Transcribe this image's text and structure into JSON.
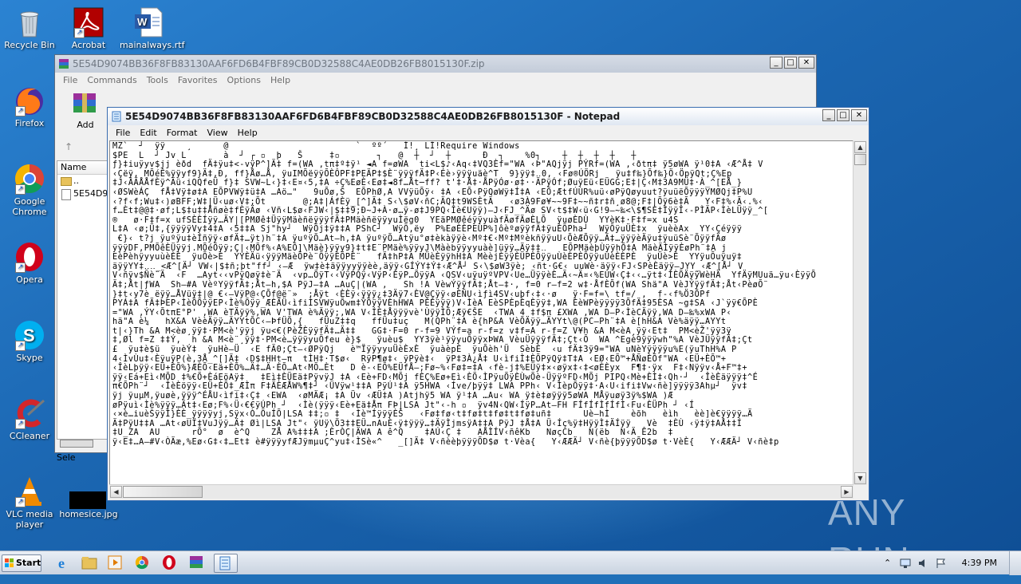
{
  "desktop": {
    "icons": [
      {
        "label": "Recycle Bin",
        "icon": "recycle-bin-icon"
      },
      {
        "label": "Acrobat",
        "icon": "acrobat-icon"
      },
      {
        "label": "mainalways.rtf",
        "icon": "word-document-icon"
      },
      {
        "label": "Firefox",
        "icon": "firefox-icon"
      },
      {
        "label": "Google Chrome",
        "icon": "chrome-icon"
      },
      {
        "label": "Opera",
        "icon": "opera-icon"
      },
      {
        "label": "Skype",
        "icon": "skype-icon"
      },
      {
        "label": "CCleaner",
        "icon": "ccleaner-icon"
      },
      {
        "label": "VLC media player",
        "icon": "vlc-icon"
      },
      {
        "label": "homesice.jpg",
        "icon": "image-file-icon"
      }
    ],
    "watermark": "ANY RUN"
  },
  "winrar": {
    "title": "5E54D9074BB36F8FB83130AAF6FD6B4FBF89CB0D32588C4AE0DB26FB8015130F.zip",
    "menu": [
      "File",
      "Commands",
      "Tools",
      "Favorites",
      "Options",
      "Help"
    ],
    "toolbar_add_label": "Add",
    "column_name": "Name",
    "rows": [
      "..",
      "5E54D9"
    ],
    "status_partial": "Sele"
  },
  "notepad": {
    "title": "5E54D9074BB36F8FB83130AAF6FD6B4FBF89CB0D32588C4AE0DB26FB8015130F - Notepad",
    "menu": [
      "File",
      "Edit",
      "Format",
      "View",
      "Help"
    ],
    "lines": [
      "MZ`  ┘  ÿÿ    ¸      @                        `  ºº´   Í!¸ LÍ!Require Windows",
      "$PE  L  ┘ Jv L       à  ┘ ┌ ▫  þ   Š     ‡▫       ┐   @  ┼  ┘  ┼      Ð  ┐    %0┐    ┼  ┼  ┼  ┼   ┼",
      "ƒ}‡iuÿyv$jj èðd  fÄ‡ÿu‡<-vÿP^]Ä‡ f=(WA ,tπ‡º‡ÿ¹ ◄A f=øWA  ti<L$♪‹Aq‹‡VQ3Èf=\"WA ‹Þ\"AQjÿj PÝRf=(WA ,‹ðtπ‡ ÿ5øWA ÿ¹0‡A ‹Æ^Å‡ V",
      "‹Çëÿ, MÕéÊ%ÿÿyf9}Ä‡,Ð, ff}Åø…Å, ÿuIMÕëÿÿÕÈÔPF‡PEÄP‡$È¨ÿÿÿfÄ‡P‹Éè›ÿÿÿuäè^T  9}ÿÿ‡‥0, ‹Fø®ÚÖRj   ÿu‡f‰}Õf‰}Ö‹ÖpÿQt;Ç%Ep",
      "‡J‹ÂÄÅÅfÈÿ^Ãü‹iQQfeÜ f}‡ SVW~L‹}‡‹E¤‹5,‡A ÷Ç%EøÈ‹Eø‡◄8f…Åt─ff? t'‡·Å‡·ÅPÿÓø·ø‡··ÄPÿÓf;ØuÿEü‹EÜGG;E‡|Ç‹M‡3A9MÜ‡·À_^[EÅ_}",
      "‹ØSWèÁÇ  fÅ‡Vÿ‡ø‡A EÕPVWÿ‡ü‡A …Aö…\"   9uÕø‚Š  EÕPhØ,A VVÿüÕÿ‹ ‡A ‹EÕ‹PÿQøWÿ‡Í‡A ‹EÕ;ÆtfÚÙR%uü‹øPÿQøyuut?ÿuüëÕÿÿÿYMØQj‡P%U",
      "‹?f‹f;Wu‡‹)øBFF;W‡|Ü‹uø‹V‡;Õt       @;A‡|ÁfÈÿ_[^]Ã‡ S‹\\$øV‹ñC;ÄQ‡t9WSÈtÃ   ‹ø3À9Fø¥~~9F‡~~ñ‡r‡ñ¸ø8@;F‡|Õÿ6è‡Ã   Y‹F‡%‹Ã‹.%‹",
      "f…Èt‡@@‡·øf;L$‡u‡‡Åñøè‡fÈÿÄø ‹Vñ‹L$ø‹FJW‹|$‡‡9;Ð~J+À·ø…ÿ-ø‡J9PQ‹Îè€Uÿÿ)—J‹FJ_^Äø SV‹t$‡W‹ü‹G!9—~‰<\\$¶SÈ‡ÌÿÿÎ‹-PÌÄP‹ÌèLÜÿÿ_^[",
      "®   ø·F‡f=x ufSÈÈÍÿÿ…ÄY|[PMØê‡ÜÿÿMäèñëÿÿÿfÄ‡PMäèñëÿÿyuÌëg0  YEäPMØêéÿÿyuàfÄøfÄøÈLÕ  ÿuøÈDÙ  YYèK‡·F‡f=x u4S",
      "L‡A ‹ø;Ü‡,{ÿÿÿÿVy‡4‡A ‹5‡‡A Sj\"hy┘  WÿÕj‡ÿ‡‡A PShC┘  WÿÕ,ëy  P%EøÈÈPEÙP%]ôèºøÿÿfÄ‡ÿuÈÕPha┘  WÿÕÿuÜÈ‡x  ÿuèèAx  YY‹Çéÿÿÿ",
      " €}‹ t?j ÿuºÿu‡èÍñÿÿ‹øfÄ‡…ÿt)h¨‡A ÿuºÿÕ…At—h‚‡A ÿuºÿÕ…Atÿu°ø‡èkàÿÿè‹Mº‡€‹Mº‡MºèkñÿÿuU‹ÕèÆÕÿÿ…Ä‡…ÿÿÿèÄÿu‡ÿuüSè¨ÕÿÿfÄø",
      "ÿÿÿDF,PMÕêÈÜÿÿj.MÕéÕÿÿ;Ç|‹MÕf%‹A%EÕ]\\Mäè}ÿÿy9}‡t‡E¨PMäè%ÿÿyJ\\Màèbÿÿyyuàè]üÿÿ…Äÿ‡‡‥   EÕPMäèþÙÿÿhÕ‡A MäèÄÌÿÿÈøPh¨‡A j",
      "EèPèhÿyyuùèÈÈ  ÿuÕè>È  YYÈÄü‹ÿÿÿMäèÕPè¨ÕÿÿÈÕPÈ¨   fÄ‡hP‡A MÜèÈÿÿhH‡A MèèjÈÿÿÈÜPÈÕÿÿuÙèÈPÈÕÿÿuÙèÈÈPÈ  ÿuÜè>È  YYÿuÕuÿuÿ‡",
      "äÿÿYY‡‥‥_<Æ^[Ä┘ VW‹|$‡ñ;þt\"ff┘ ‹—Æ  ÿw‡è‡äÿÿyyÿÿèè‚äÿÿ‹GÍÝY‡Ý‡‹Æ^Å┘ S‹\\$øW3ÿè; ‹ñt·G€‹ uuWè·äÿÿ‹FJ‹SPèÈäÿÿ—JYY_‹Æ^[Å┘ V",
      "V‹ñÿv$Ñè¨Ä  ‹F  …Ayt‹‹vPÿQøÿ‡è¨Ä  ‹vp…ÕÿT‹‹VÿPQÿ‹VÿP‹ÈÿP…ÕÿÿA ‹QSV‹uÿuÿºVPV‹Ue…ÜÿÿèÈ…Ã‹~Ä¤‹%EUW‹Ç‡‹‹…ÿt‡‹ÌÈÕÄÿÿWèHÄ  YfÄÿMUuä…ÿu‹ÈÿÿÕ",
      "Ä‡;Åt|ƒWA  Sh—#A VèºYÿÿfÄ‡;Åt—h,$A PÿJ—‡A …AuÇ|(WA ,   Sh !A VèwÝÿÿfÄ‡;Åt—‡·‚ f=0 r—f=2 w‡·ÅfÈÕf(WA Shä\"A VèJÝÿÿfÄ‡;Åt‹PèøÕ¨",
      "}‡t‹y7è ëÿÿ…ÅVüÿ‡|@ €‹—VÿP@‹ÇÕf@ë¨»  ;Åÿt ‹ÈÈÿ‹ÿÿÿ¿‡3Äÿ7‹ÈV@Çÿÿ‹øÈÑU‹ìƒì4SV‹uþf‹‡‹·ø   ÿ·F=f=\\ tf=/ ,  f-‹f%Ö3ÕPf",
      "PYÁ‡A fÄ‡ÞEP‹ÌèÕÕÿÿEP‹Ìè%Õÿÿ_ÆÈÄÜ‹ìfiÌSVWÿuÕwm‡ÝÕÿÿVÈhHWA PÈÈÿÿÿ)V‹ÌèA EèSPÈpÈqÈÿÿ‡,WA ÈèWPèÿÿÿÿ3ÕfÄ‡95ÈSA ~g‡SA ‹J`ÿÿ€ÕPÈ",
      "=\"WA ,ÝY‹ÕtπE°P' ‚WA èTÄÿÿ%,WA V'TWA è%Äÿÿ;‚WA V‹ÍÈ‡Åÿÿÿvè'ÙÿÿÌÕ;Æÿ€ŠE  ‹TWA 4 ‡f$π £XWA ‚WA D—P‹ÌèCÄÿÿ‚WA D—‰%xWA P‹",
      "hä\"A è¼   hX&A VèèÄÿÿ…ÄYYtÕC‹—ÞfÜÕ‚{   fÜuZ‡‡q   ffÜu‡uç   M(QPh¨‡A è{hP&A VèÕÄÿÿ…ÄYYt\\@(PC—Ph¨‡A è[hH&A Vè%äÿÿ…AYYt",
      "t|‹}Th &A M<èø¸ÿÿ‡·PM<è'ÿÿj ÿu<€(PèŽÈÿÿfÄ‡…Ä‡‡   GG‡·F=0 r-f=9 VÝf=a r-f=z v‡f=A r-f=Z V¥h &A M<èA¸ÿÿ‹Et‡  PM<èŽ'ÿÿ3ÿ",
      "‡,Øl f=Z ‡‡Ý‚  h &A M<è¨¸ÿÿ‡·PM<è…ÿÿÿyuÕfeu è}$   ÿuèu$  YY3ÿè¹ÿÿyuÕÿÿxÞWA VèuÜÿÿÿfÄ‡;Çt‹Õ  WA ^Egè9ÿÿÿwh\"%A VèJÜÿÿfÄ‡;Çt",
      "£  ÿu‡è$ü  ÿuèÝ‡  ÿuHè—Ü  ‹E fÄ0;Çt—‹ØPÿQj   è™ÏÿÿyyuÜèÈxÈ  ÿuàèpÈ  ÿuÕèh'Ü  SèbÈ  ‹u fÄ‡3ÿ9=\"WA uNèYÿÿÿÿu%E(ÿuThH%A P",
      "4‹ÌvÙu‡‹ÈÿuÿP(è,3Å_^[]Ä‡ ‹D$‡HHt—π  tÌH‡·T$ø‹  RÿP¶ø‡‹ ÿPÿè‡‹  ÿP‡3À¿Å‡ U‹ìfiÌ‡ÈÕPÿQÿ‡T‡A ‹EØ‹EÕ™+ÅÑøÈÕf\"WA ‹EÜ+ÈÕ™+",
      "‹ÎèLþÿÿ‹EÜ+ÈÕ%}ÆÈÕ‹Eä+ÈÕ%…Ä‡…Ä·ÈÕ…At‹MÕ…Èt   D è-‹EÕ%EÜfÅ—;Fø~%‹Fø‡=‡A ‹fè-j‡%EÜÿ‡×‹øÿx‡‹‡<øÈÈyx  F¶‡·ÿx  F‡‹Nÿÿv‹Å+F™‡+",
      "ÿÿ‹Eá+Eì‹MÕD ‡%€Õ+ÈáEöAÿ‡   ‡Eì‡ÈÜEä‡PÿvÿJ ‡A ‹Eè+FD‹MÕj fÈÇ%Eø+Eì‹ÈÕ‹ÌPÿuÕÿÈÙwÕè-ÜÿÿºFD‹MÕj PIPQ‹Mè+ÈÌ‡‹Qh·┘  ‹ÎèÈäÿÿÿ‡^É",
      "π€ÕPh¨┘  ‹ÎèÈöÿÿ‹EÜ+ÈÕ‡_ÆÌπ F‡ÄÈÆÅW%¶‡┘ ‹ÜVÿw¹‡‡A PÿÚ¹‡A ÿ5HWA ‹Íve/þÿÿ‡ LWA PPh‹ V‹ÌèpÕÿÿ‡·A‹U‹ifi‡Vw‹ñè]ÿÿÿÿ3Ahµ┘  ÿv‡",
      "ÿj ÿuµM,ÿuøè,ÿÿÿ^ÉÅU‹ìfi‡‹Ç‡ ‹EWA  ‹øMÄÆ¡ ‡A Üv ‹ÆÜ‡A )Atjhÿ5 WA ÿ¹‡A …Au‹ WA ÿ‡è‡øÿÿÿ5øWA MÅÿuøÿ3ÿ%$WA )Æ",
      "øPÿuì‹Ìè%ÿÿÿ…Ät‡‹Eø;F%‹Ü‹€€ÿÚPh ┘  ‹Ìè(ÿÿÿ‹Eè+Eä‡Åπ FÞ|LSA Jt\"‹-h ▫  ÿv4N‹QW‹ÍÿP…At—FH FÍfÍfÌfÍfÌ‹Fu‹ÈÜPh ┘ ‹Í",
      "‹×è…iuèŠÿÿÍ}ÈÈ_ÿÿÿÿyj,Sÿx‹Ò…ÕuÍÕ|LSA ‡‡;▫ ‡  ‹Ìè™ÍÿÿÿÈŠ   ‹Fø‡fø‹t‡fø‡t‡fø‡t‡fø‡uñ‡      Uè—hÌ    èõh   èìh   èè]è€ÿÿÿÿ…Ä",
      "Ä‡PÿU‡‡A …At‹øUÏ‡VuJÿÿ…Ä‡ Øì|LSA Jt\"‹ ÿUÿ\\Ö3‡‡EÜ…nAuÈ‹ÿ‡ÿÿÿ…‡ÄÿÌjmsÿA‡‡A PÿJ ‡Å‡A Ü‹Íç%ÿ‡HÿÿÌ‡ÄÍÿÿ   Vè  ‡ÈÙ ‹ÿ‡ÿ‡AÅ‡‡Í",
      "‡U_ZA  AU      rÕ°  ø  è^Q    ZÅ A%‡‡‡A ;ÈrÒÇ|ÄWA A ê^Q    ‡AÚ‹Ç ‡   AÅÌÍV‹ñêKb   NøçCb   N(ëb  N‹Ä Ê2b  ‡",
      "ÿ‹E‡…A—#V‹ÒÄæ‚%Eø‹G‡‹‡…Et‡ è#ÿÿÿyfÆJÿmµuÇ^yu‡‹ÌSè«^   _[]Ä‡ V‹ñèèþÿÿÿÕD$ø t·Vèa{   Y‹ÆÆÄ┘ V‹ñè{þÿÿÿÕD$ø t·VèÈ{   Y‹ÆÆÄ┘ V‹ñè‡p"
    ]
  },
  "taskbar": {
    "start_label": "Start",
    "clock": "4:39 PM",
    "buttons": [
      "ie-icon",
      "explorer-icon",
      "media-player-icon",
      "chrome-icon",
      "opera-icon",
      "winrar-icon",
      "notepad-icon"
    ]
  }
}
